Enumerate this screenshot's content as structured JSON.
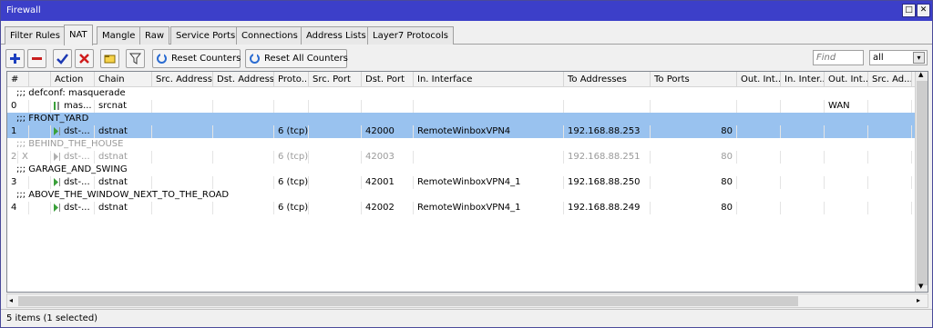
{
  "window": {
    "title": "Firewall",
    "restore_glyph": "□",
    "close_glyph": "✕"
  },
  "tabs": [
    {
      "label": "Filter Rules"
    },
    {
      "label": "NAT"
    },
    {
      "label": "Mangle"
    },
    {
      "label": "Raw"
    },
    {
      "label": "Service Ports"
    },
    {
      "label": "Connections"
    },
    {
      "label": "Address Lists"
    },
    {
      "label": "Layer7 Protocols"
    }
  ],
  "toolbar": {
    "reset_counters": "Reset Counters",
    "reset_all_counters": "Reset All Counters",
    "find_placeholder": "Find",
    "filter_value": "all",
    "filter_arrow": "▾"
  },
  "columns": [
    "#",
    "",
    "Action",
    "Chain",
    "Src. Address",
    "Dst. Address",
    "Proto...",
    "Src. Port",
    "Dst. Port",
    "In. Interface",
    "To Addresses",
    "To Ports",
    "Out. Int...",
    "In. Inter...",
    "Out. Int...",
    "Src. Ad...",
    "D"
  ],
  "rows": [
    {
      "comment": ";;; defconf: masquerade"
    },
    {
      "num": "0",
      "flag": "",
      "action": "mas...",
      "chain": "srcnat",
      "proto": "",
      "dst_port": "",
      "in_iface": "",
      "to_addr": "",
      "to_ports": "",
      "out_int2": "WAN"
    },
    {
      "comment": ";;; FRONT_YARD",
      "selected": true
    },
    {
      "num": "1",
      "flag": "",
      "action": "dst-...",
      "chain": "dstnat",
      "proto": "6 (tcp)",
      "dst_port": "42000",
      "in_iface": "RemoteWinboxVPN4",
      "to_addr": "192.168.88.253",
      "to_ports": "80",
      "out_int2": "",
      "selected": true
    },
    {
      "comment": ";;; BEHIND_THE_HOUSE",
      "disabled": true
    },
    {
      "num": "2",
      "flag": "X",
      "action": "dst-...",
      "chain": "dstnat",
      "proto": "6 (tcp)",
      "dst_port": "42003",
      "in_iface": "",
      "to_addr": "192.168.88.251",
      "to_ports": "80",
      "out_int2": "",
      "disabled": true
    },
    {
      "comment": ";;; GARAGE_AND_SWING"
    },
    {
      "num": "3",
      "flag": "",
      "action": "dst-...",
      "chain": "dstnat",
      "proto": "6 (tcp)",
      "dst_port": "42001",
      "in_iface": "RemoteWinboxVPN4_1",
      "to_addr": "192.168.88.250",
      "to_ports": "80",
      "out_int2": ""
    },
    {
      "comment": ";;; ABOVE_THE_WINDOW_NEXT_TO_THE_ROAD"
    },
    {
      "num": "4",
      "flag": "",
      "action": "dst-...",
      "chain": "dstnat",
      "proto": "6 (tcp)",
      "dst_port": "42002",
      "in_iface": "RemoteWinboxVPN4_1",
      "to_addr": "192.168.88.249",
      "to_ports": "80",
      "out_int2": ""
    }
  ],
  "scroll": {
    "up": "▲",
    "down": "▼",
    "left": "◂",
    "right": "▸"
  },
  "status": "5 items (1 selected)",
  "colors": {
    "titlebar": "#3c3fc9",
    "selected_row": "#99c2ef",
    "add": "#1c3fbf",
    "remove": "#c81e1e",
    "enable": "#1d39b3",
    "disable": "#cf1c1c"
  }
}
